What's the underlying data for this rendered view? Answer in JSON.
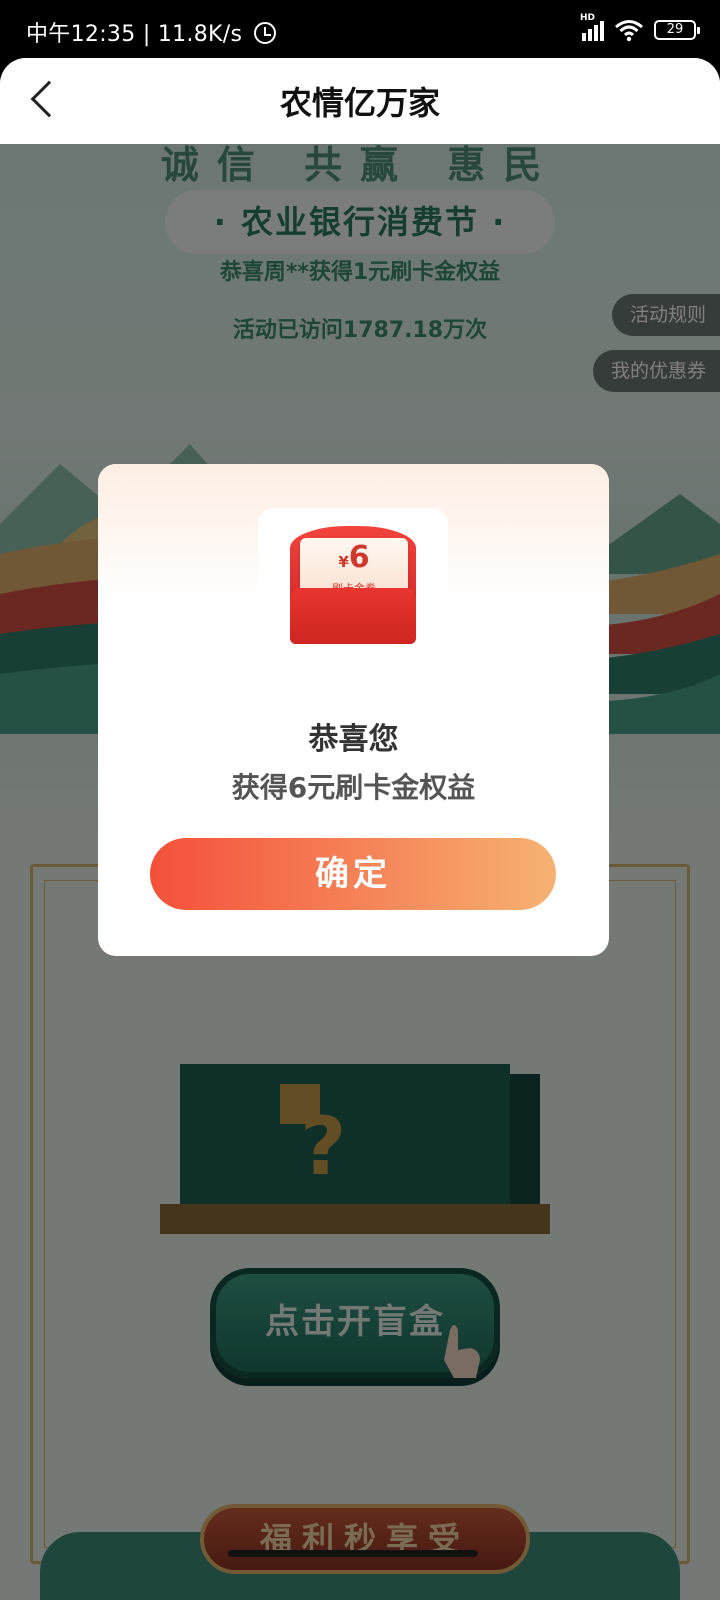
{
  "status_bar": {
    "time": "中午12:35",
    "speed": "11.8K/s",
    "battery": "29"
  },
  "nav": {
    "title": "农情亿万家"
  },
  "page": {
    "slogan": "诚信 共赢 惠民",
    "festival": "· 农业银行消费节 ·",
    "winner_notice": "恭喜周**获得1元刷卡金权益",
    "visits": "活动已访问1787.18万次",
    "rules_button": "活动规则",
    "coupons_button": "我的优惠券",
    "open_box_button": "点击开盲盒",
    "welfare_banner": "福利秒享受"
  },
  "modal": {
    "coupon_amount": "6",
    "coupon_currency": "¥",
    "coupon_type": "— 刷卡金券 —",
    "title": "恭喜您",
    "message": "获得6元刷卡金权益",
    "confirm_button": "确定"
  }
}
